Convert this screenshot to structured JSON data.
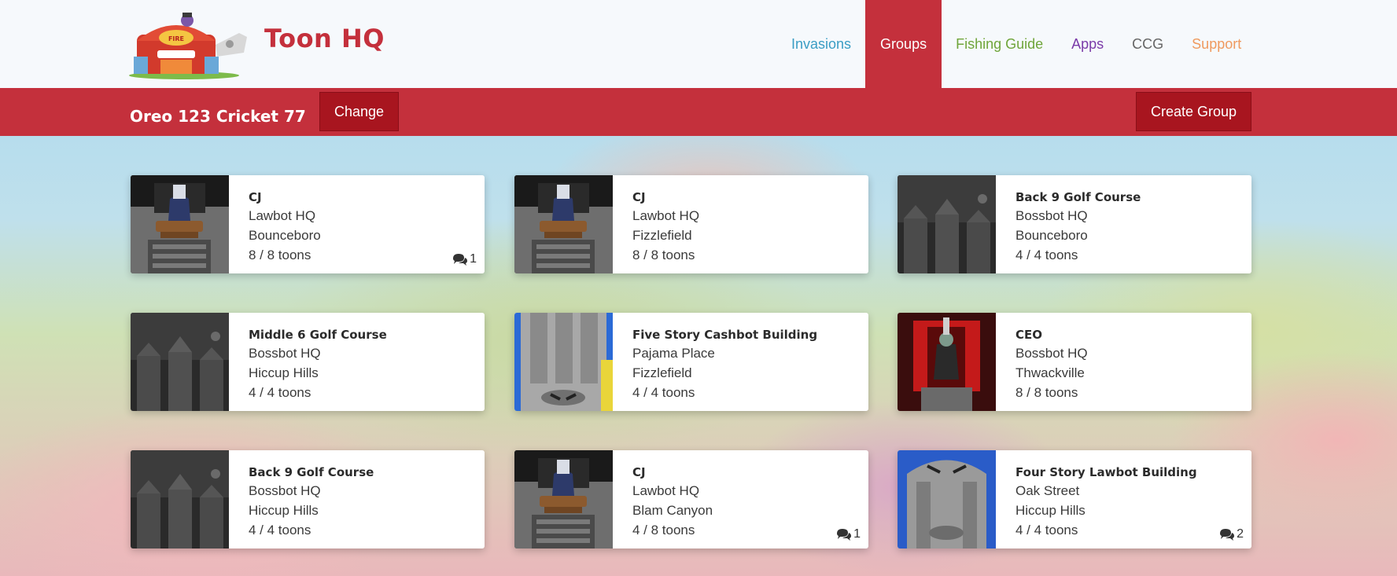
{
  "brand": {
    "name": "Toon HQ"
  },
  "nav": [
    {
      "label": "Invasions",
      "color": "#3a9dc4",
      "active": false
    },
    {
      "label": "Groups",
      "color": "#ffffff",
      "active": true
    },
    {
      "label": "Fishing Guide",
      "color": "#6fa53a",
      "active": false
    },
    {
      "label": "Apps",
      "color": "#7a3aa8",
      "active": false
    },
    {
      "label": "CCG",
      "color": "#666666",
      "active": false
    },
    {
      "label": "Support",
      "color": "#ef9a5e",
      "active": false
    }
  ],
  "subbar": {
    "toon_name": "Oreo 123 Cricket 77",
    "change_label": "Change",
    "create_label": "Create Group"
  },
  "colors": {
    "accent": "#c4303c",
    "button_dark": "#a8151f"
  },
  "groups": [
    {
      "title": "CJ",
      "hq": "Lawbot HQ",
      "district": "Bounceboro",
      "toons": "8 / 8 toons",
      "comments": "1",
      "thumb": "cj"
    },
    {
      "title": "CJ",
      "hq": "Lawbot HQ",
      "district": "Fizzlefield",
      "toons": "8 / 8 toons",
      "comments": "",
      "thumb": "cj"
    },
    {
      "title": "Back 9 Golf Course",
      "hq": "Bossbot HQ",
      "district": "Bounceboro",
      "toons": "4 / 4 toons",
      "comments": "",
      "thumb": "golf"
    },
    {
      "title": "Middle 6 Golf Course",
      "hq": "Bossbot HQ",
      "district": "Hiccup Hills",
      "toons": "4 / 4 toons",
      "comments": "",
      "thumb": "golf"
    },
    {
      "title": "Five Story Cashbot Building",
      "hq": "Pajama Place",
      "district": "Fizzlefield",
      "toons": "4 / 4 toons",
      "comments": "",
      "thumb": "cashbot"
    },
    {
      "title": "CEO",
      "hq": "Bossbot HQ",
      "district": "Thwackville",
      "toons": "8 / 8 toons",
      "comments": "",
      "thumb": "ceo"
    },
    {
      "title": "Back 9 Golf Course",
      "hq": "Bossbot HQ",
      "district": "Hiccup Hills",
      "toons": "4 / 4 toons",
      "comments": "",
      "thumb": "golf"
    },
    {
      "title": "CJ",
      "hq": "Lawbot HQ",
      "district": "Blam Canyon",
      "toons": "4 / 8 toons",
      "comments": "1",
      "thumb": "cj"
    },
    {
      "title": "Four Story Lawbot Building",
      "hq": "Oak Street",
      "district": "Hiccup Hills",
      "toons": "4 / 4 toons",
      "comments": "2",
      "thumb": "lawbot"
    }
  ]
}
